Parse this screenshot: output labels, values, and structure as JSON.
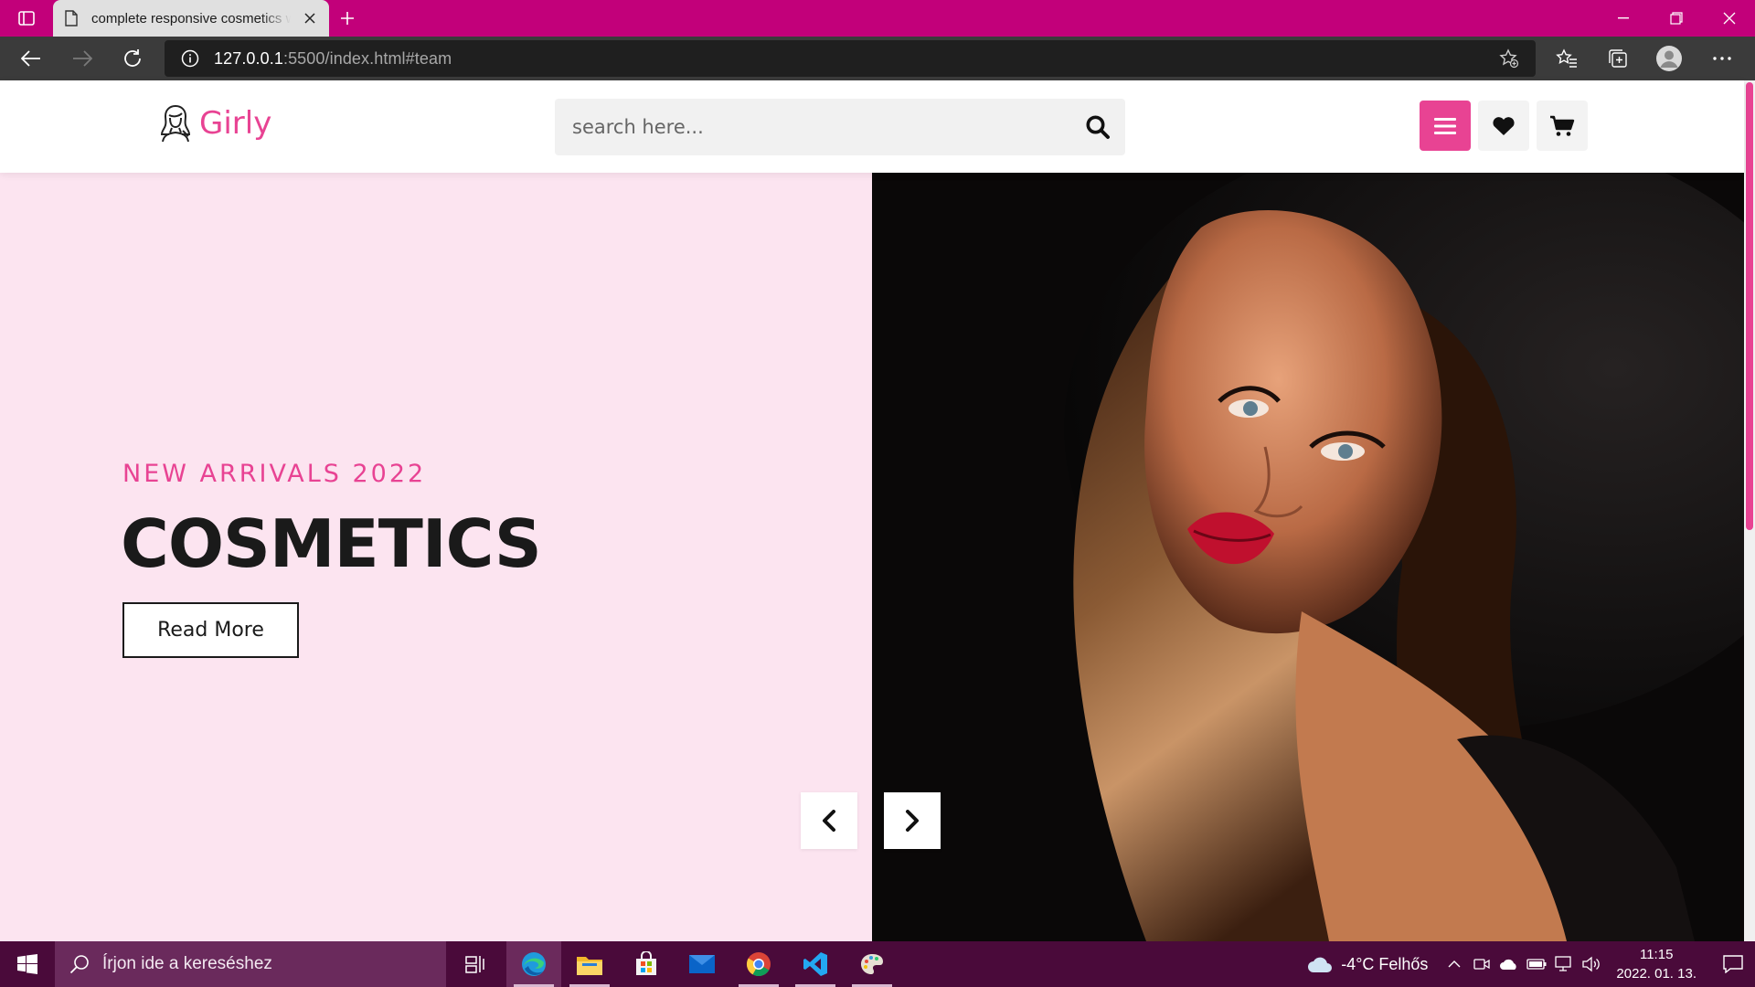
{
  "browser": {
    "tab_title": "complete responsive cosmetics website design",
    "url_host": "127.0.0.1",
    "url_rest": ":5500/index.html#team"
  },
  "header": {
    "logo_text": "Girly",
    "search_placeholder": "search here...",
    "icons": [
      "menu-icon",
      "heart-icon",
      "cart-icon"
    ]
  },
  "hero": {
    "subtitle": "NEW ARRIVALS 2022",
    "title": "COSMETICS",
    "button_label": "Read More"
  },
  "taskbar": {
    "search_placeholder": "Írjon ide a kereséshez",
    "weather": "-4°C  Felhős",
    "time": "11:15",
    "date": "2022. 01. 13.",
    "apps": [
      "task-view",
      "edge",
      "file-explorer",
      "store",
      "mail",
      "chrome",
      "vscode",
      "paint"
    ]
  },
  "colors": {
    "accent": "#e84393",
    "tabbar": "#c2007a",
    "hero_bg": "#fce4f0",
    "taskbar": "#4a0a3a"
  }
}
